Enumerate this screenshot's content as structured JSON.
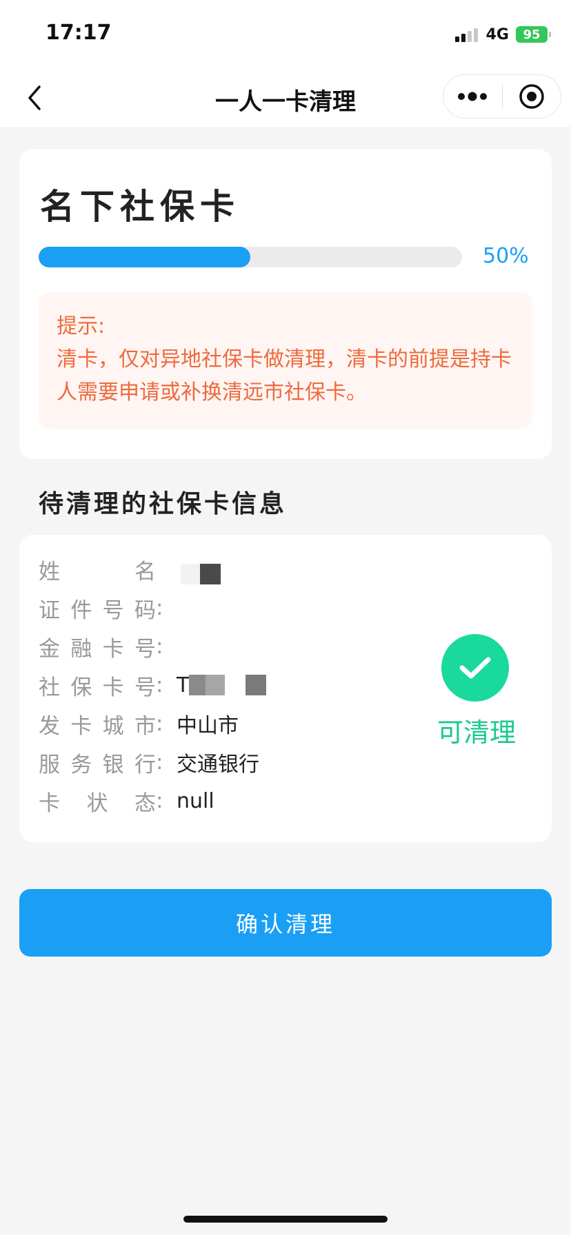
{
  "status_bar": {
    "time": "17:17",
    "network": "4G",
    "battery": "95"
  },
  "nav": {
    "title": "一人一卡清理",
    "icons": [
      "chevron-left-icon",
      "more-dots-icon",
      "target-icon"
    ]
  },
  "summary_card": {
    "title": "名下社保卡",
    "progress_percent": 50,
    "progress_text": "50%",
    "tip_title": "提示:",
    "tip_text": "清卡，仅对异地社保卡做清理，清卡的前提是持卡人需要申请或补换清远市社保卡。"
  },
  "section": {
    "title": "待清理的社保卡信息"
  },
  "card_info": {
    "rows": [
      {
        "label": [
          "姓",
          "名"
        ],
        "colon": "",
        "value": ""
      },
      {
        "label": [
          "证",
          "件",
          "号",
          "码"
        ],
        "colon": ":",
        "value": ""
      },
      {
        "label": [
          "金",
          "融",
          "卡",
          "号"
        ],
        "colon": ":",
        "value": ""
      },
      {
        "label": [
          "社",
          "保",
          "卡",
          "号"
        ],
        "colon": ":",
        "value": "T"
      },
      {
        "label": [
          "发",
          "卡",
          "城",
          "市"
        ],
        "colon": ":",
        "value": "中山市"
      },
      {
        "label": [
          "服",
          "务",
          "银",
          "行"
        ],
        "colon": ":",
        "value": "交通银行"
      },
      {
        "label": [
          "卡",
          "状",
          "态"
        ],
        "colon": ":",
        "value": "null"
      }
    ],
    "status_icon": "check-circle-icon",
    "status_text": "可清理"
  },
  "actions": {
    "confirm_label": "确认清理"
  },
  "colors": {
    "primary": "#1a9ff5",
    "success": "#19d99c",
    "warning_text": "#ee6a3c",
    "warning_bg": "#fff5f3"
  }
}
